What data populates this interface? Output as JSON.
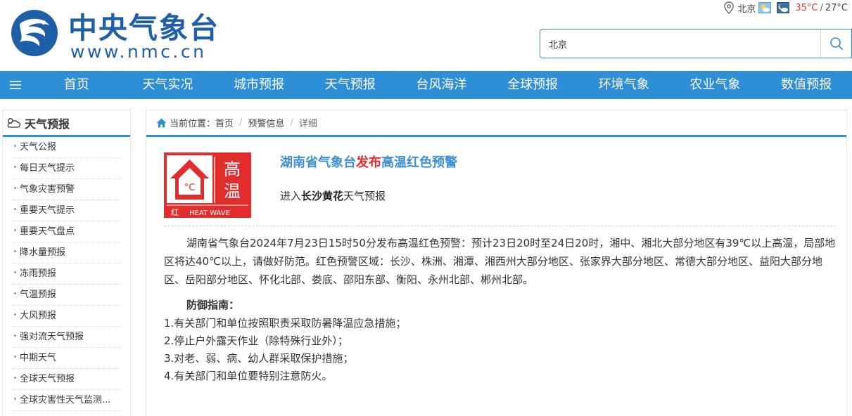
{
  "header": {
    "site_title": "中央气象台",
    "site_url": "www.nmc.cn",
    "weather": {
      "city": "北京",
      "temp_high": "35°C",
      "separator": "/",
      "temp_low": "27°C"
    },
    "search": {
      "value": "北京"
    }
  },
  "nav": {
    "items": [
      "首页",
      "天气实况",
      "城市预报",
      "天气预报",
      "台风海洋",
      "全球预报",
      "环境气象",
      "农业气象",
      "数值预报"
    ]
  },
  "sidebar": {
    "title": "天气预报",
    "items": [
      "天气公报",
      "每日天气提示",
      "气象灾害预警",
      "重要天气提示",
      "重要天气盘点",
      "降水量预报",
      "冻雨预报",
      "气温预报",
      "大风预报",
      "强对流天气预报",
      "中期天气",
      "全球天气预报",
      "全球灾害性天气监测..."
    ]
  },
  "breadcrumb": {
    "prefix": "当前位置：",
    "home": "首页",
    "section": "预警信息",
    "current": "详细"
  },
  "alert": {
    "icon": {
      "type_text_1": "高",
      "type_text_2": "温",
      "level": "红",
      "label_en": "HEAT WAVE",
      "thermometer_unit": "°C",
      "color": "#e32d2d"
    },
    "title_prefix": "湖南省气象台",
    "title_verb": "发布",
    "title_suffix": "高温红色预警",
    "link_prefix": "进入",
    "link_place": "长沙黄花",
    "link_suffix": "天气预报",
    "body": "湖南省气象台2024年7月23日15时50分发布高温红色预警：预计23日20时至24日20时，湘中、湘北大部分地区有39℃以上高温，局部地区将达40℃以上，请做好防范。红色预警区域：长沙、株洲、湘潭、湘西州大部分地区、张家界大部分地区、常德大部分地区、益阳大部分地区、岳阳部分地区、怀化北部、娄底、邵阳东部、衡阳、永州北部、郴州北部。",
    "guide_title": "防御指南：",
    "guide_items": [
      "1.有关部门和单位按照职责采取防暑降温应急措施；",
      "2.停止户外露天作业（除特殊行业外）；",
      "3.对老、弱、病、幼人群采取保护措施；",
      "4.有关部门和单位要特别注意防火。"
    ]
  },
  "colors": {
    "brand_blue": "#1f5fa8",
    "nav_blue": "#2f8fd6",
    "title_blue": "#3b8fd4",
    "warning_red": "#e32d2d",
    "temp_red": "#e23a2c"
  }
}
